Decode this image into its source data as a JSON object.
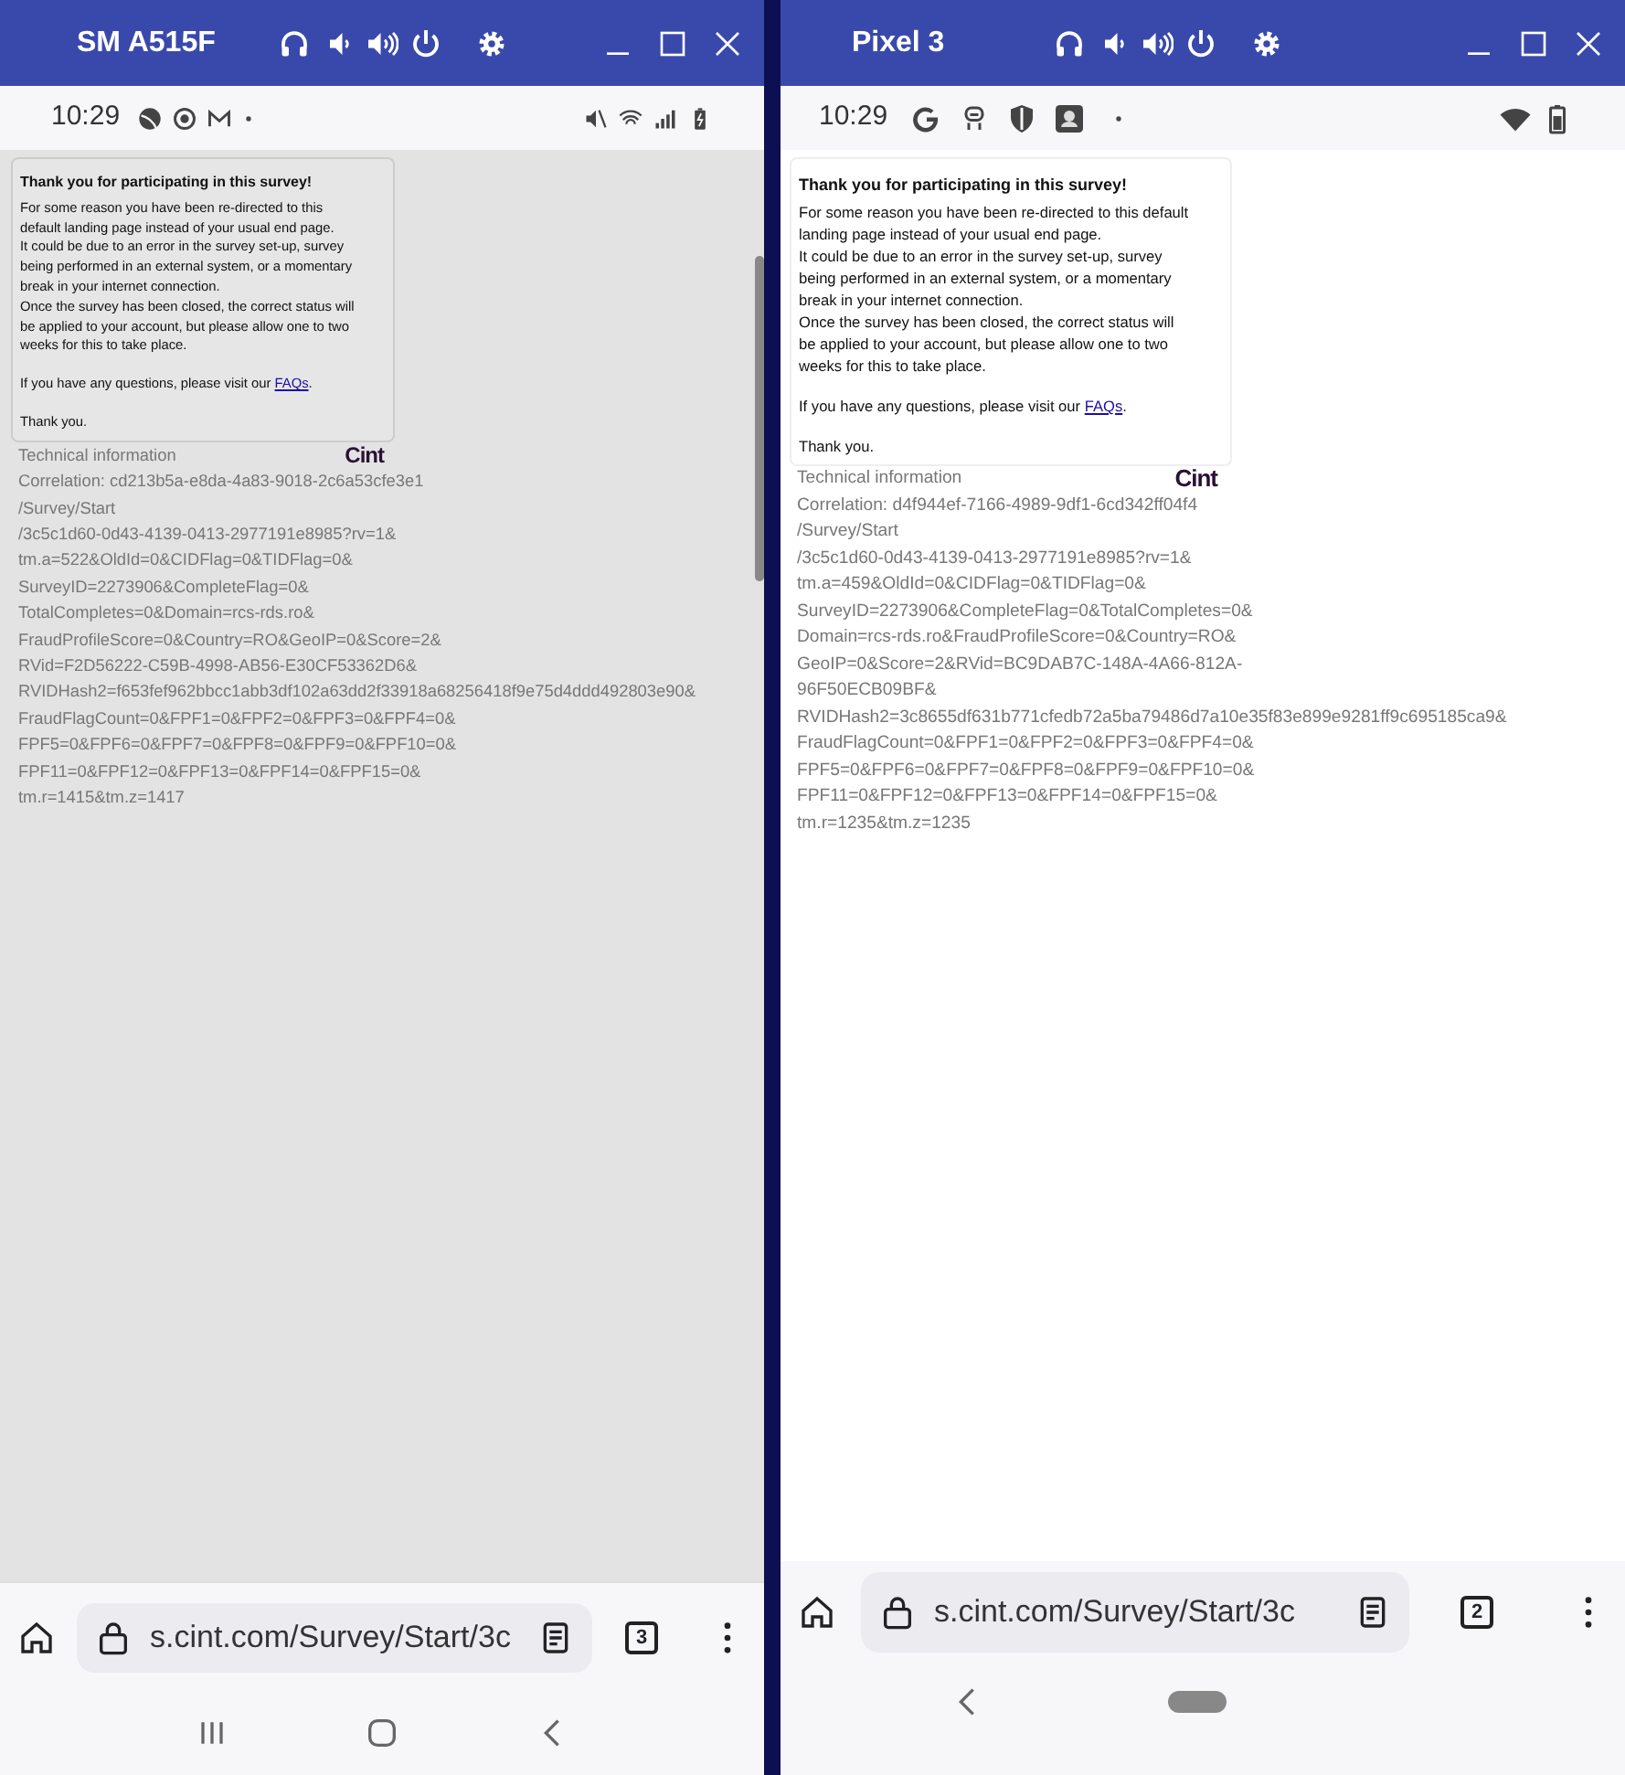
{
  "windows": [
    {
      "kind": "samsung",
      "title": "SM A515F",
      "dimmed": true,
      "status_time": "10:29",
      "card": {
        "heading": "Thank you for participating in this survey!",
        "lines": [
          "For some reason you have been re-directed to this",
          "default landing page instead of your usual end page.",
          "It could be due to an error in the survey set-up, survey",
          "being performed in an external system, or a momentary",
          "break in your internet connection.",
          "Once the survey has been closed, the correct status will",
          "be applied to your account, but please allow one to two",
          "weeks for this to take place."
        ],
        "faq_prefix": "If you have any questions, please visit our ",
        "faq_link": "FAQs",
        "faq_suffix": ".",
        "closing": "Thank you."
      },
      "technical": {
        "label": "Technical information",
        "logo": "Cint",
        "lines": [
          "Correlation: cd213b5a-e8da-4a83-9018-2c6a53cfe3e1",
          "/Survey/Start",
          "/3c5c1d60-0d43-4139-0413-2977191e8985?rv=1&",
          "tm.a=522&OldId=0&CIDFlag=0&TIDFlag=0&",
          "SurveyID=2273906&CompleteFlag=0&",
          "TotalCompletes=0&Domain=rcs-rds.ro&",
          "FraudProfileScore=0&Country=RO&GeoIP=0&Score=2&",
          "RVid=F2D56222-C59B-4998-AB56-E30CF53362D6&",
          "RVIDHash2=f653fef962bbcc1abb3df102a63dd2f33918a68256418f9e75d4ddd492803e90&",
          "FraudFlagCount=0&FPF1=0&FPF2=0&FPF3=0&FPF4=0&",
          "FPF5=0&FPF6=0&FPF7=0&FPF8=0&FPF9=0&FPF10=0&",
          "FPF11=0&FPF12=0&FPF13=0&FPF14=0&FPF15=0&",
          "tm.r=1415&tm.z=1417"
        ]
      },
      "address_bar": {
        "url": "s.cint.com/Survey/Start/3c",
        "tab_count": "3"
      }
    },
    {
      "kind": "pixel",
      "title": "Pixel 3",
      "dimmed": false,
      "status_time": "10:29",
      "card": {
        "heading": "Thank you for participating in this survey!",
        "lines": [
          "For some reason you have been re-directed to this default",
          "landing page instead of your usual end page.",
          "It could be due to an error in the survey set-up, survey",
          "being performed in an external system, or a momentary",
          "break in your internet connection.",
          "Once the survey has been closed, the correct status will",
          "be applied to your account, but please allow one to two",
          "weeks for this to take place."
        ],
        "faq_prefix": "If you have any questions, please visit our ",
        "faq_link": "FAQs",
        "faq_suffix": ".",
        "closing": "Thank you."
      },
      "technical": {
        "label": "Technical information",
        "logo": "Cint",
        "lines": [
          "Correlation: d4f944ef-7166-4989-9df1-6cd342ff04f4",
          "/Survey/Start",
          "/3c5c1d60-0d43-4139-0413-2977191e8985?rv=1&",
          "tm.a=459&OldId=0&CIDFlag=0&TIDFlag=0&",
          "SurveyID=2273906&CompleteFlag=0&TotalCompletes=0&",
          "Domain=rcs-rds.ro&FraudProfileScore=0&Country=RO&",
          "GeoIP=0&Score=2&RVid=BC9DAB7C-148A-4A66-812A-",
          "96F50ECB09BF&",
          "RVIDHash2=3c8655df631b771cfedb72a5ba79486d7a10e35f83e899e9281ff9c695185ca9&",
          "FraudFlagCount=0&FPF1=0&FPF2=0&FPF3=0&FPF4=0&",
          "FPF5=0&FPF6=0&FPF7=0&FPF8=0&FPF9=0&FPF10=0&",
          "FPF11=0&FPF12=0&FPF13=0&FPF14=0&FPF15=0&",
          "tm.r=1235&tm.z=1235"
        ]
      },
      "address_bar": {
        "url": "s.cint.com/Survey/Start/3c",
        "tab_count": "2"
      }
    }
  ]
}
